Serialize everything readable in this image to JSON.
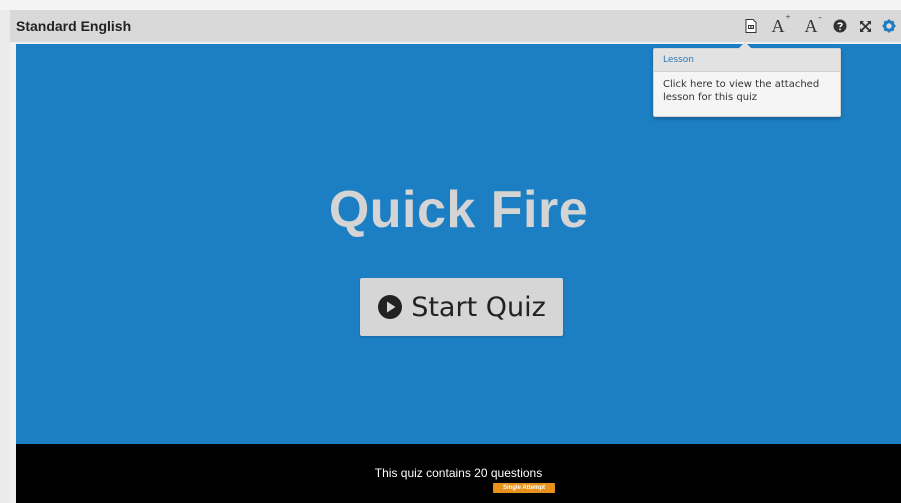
{
  "header": {
    "title": "Standard English",
    "toolbar": [
      {
        "name": "lesson-icon",
        "label": ""
      },
      {
        "name": "font-increase-icon",
        "label": "A",
        "sup": "+"
      },
      {
        "name": "font-decrease-icon",
        "label": "A",
        "sup": "-"
      },
      {
        "name": "help-icon",
        "label": ""
      },
      {
        "name": "fullscreen-icon",
        "label": ""
      },
      {
        "name": "settings-icon",
        "label": ""
      }
    ]
  },
  "tooltip": {
    "title": "Lesson",
    "body": "Click here to view the attached lesson for this quiz"
  },
  "quiz": {
    "title": "Quick Fire",
    "start_label": "Start Quiz"
  },
  "footer": {
    "info": "This quiz contains 20 questions",
    "badge": "Single Attempt"
  },
  "colors": {
    "stage": "#1c7fc4",
    "titlebar": "#d9d9d9",
    "footer": "#000000",
    "badge": "#e8921c"
  }
}
